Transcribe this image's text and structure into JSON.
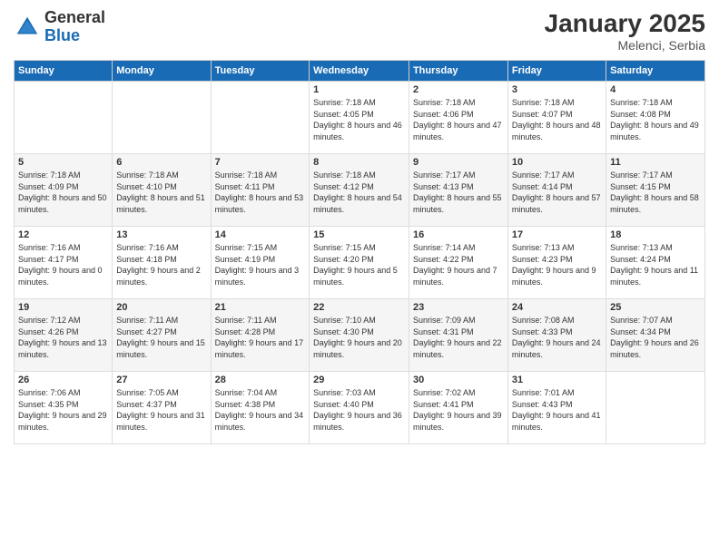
{
  "header": {
    "logo_general": "General",
    "logo_blue": "Blue",
    "month": "January 2025",
    "location": "Melenci, Serbia"
  },
  "days_of_week": [
    "Sunday",
    "Monday",
    "Tuesday",
    "Wednesday",
    "Thursday",
    "Friday",
    "Saturday"
  ],
  "weeks": [
    [
      null,
      null,
      null,
      {
        "day": "1",
        "sunrise": "7:18 AM",
        "sunset": "4:05 PM",
        "daylight": "8 hours and 46 minutes."
      },
      {
        "day": "2",
        "sunrise": "7:18 AM",
        "sunset": "4:06 PM",
        "daylight": "8 hours and 47 minutes."
      },
      {
        "day": "3",
        "sunrise": "7:18 AM",
        "sunset": "4:07 PM",
        "daylight": "8 hours and 48 minutes."
      },
      {
        "day": "4",
        "sunrise": "7:18 AM",
        "sunset": "4:08 PM",
        "daylight": "8 hours and 49 minutes."
      }
    ],
    [
      {
        "day": "5",
        "sunrise": "7:18 AM",
        "sunset": "4:09 PM",
        "daylight": "8 hours and 50 minutes."
      },
      {
        "day": "6",
        "sunrise": "7:18 AM",
        "sunset": "4:10 PM",
        "daylight": "8 hours and 51 minutes."
      },
      {
        "day": "7",
        "sunrise": "7:18 AM",
        "sunset": "4:11 PM",
        "daylight": "8 hours and 53 minutes."
      },
      {
        "day": "8",
        "sunrise": "7:18 AM",
        "sunset": "4:12 PM",
        "daylight": "8 hours and 54 minutes."
      },
      {
        "day": "9",
        "sunrise": "7:17 AM",
        "sunset": "4:13 PM",
        "daylight": "8 hours and 55 minutes."
      },
      {
        "day": "10",
        "sunrise": "7:17 AM",
        "sunset": "4:14 PM",
        "daylight": "8 hours and 57 minutes."
      },
      {
        "day": "11",
        "sunrise": "7:17 AM",
        "sunset": "4:15 PM",
        "daylight": "8 hours and 58 minutes."
      }
    ],
    [
      {
        "day": "12",
        "sunrise": "7:16 AM",
        "sunset": "4:17 PM",
        "daylight": "9 hours and 0 minutes."
      },
      {
        "day": "13",
        "sunrise": "7:16 AM",
        "sunset": "4:18 PM",
        "daylight": "9 hours and 2 minutes."
      },
      {
        "day": "14",
        "sunrise": "7:15 AM",
        "sunset": "4:19 PM",
        "daylight": "9 hours and 3 minutes."
      },
      {
        "day": "15",
        "sunrise": "7:15 AM",
        "sunset": "4:20 PM",
        "daylight": "9 hours and 5 minutes."
      },
      {
        "day": "16",
        "sunrise": "7:14 AM",
        "sunset": "4:22 PM",
        "daylight": "9 hours and 7 minutes."
      },
      {
        "day": "17",
        "sunrise": "7:13 AM",
        "sunset": "4:23 PM",
        "daylight": "9 hours and 9 minutes."
      },
      {
        "day": "18",
        "sunrise": "7:13 AM",
        "sunset": "4:24 PM",
        "daylight": "9 hours and 11 minutes."
      }
    ],
    [
      {
        "day": "19",
        "sunrise": "7:12 AM",
        "sunset": "4:26 PM",
        "daylight": "9 hours and 13 minutes."
      },
      {
        "day": "20",
        "sunrise": "7:11 AM",
        "sunset": "4:27 PM",
        "daylight": "9 hours and 15 minutes."
      },
      {
        "day": "21",
        "sunrise": "7:11 AM",
        "sunset": "4:28 PM",
        "daylight": "9 hours and 17 minutes."
      },
      {
        "day": "22",
        "sunrise": "7:10 AM",
        "sunset": "4:30 PM",
        "daylight": "9 hours and 20 minutes."
      },
      {
        "day": "23",
        "sunrise": "7:09 AM",
        "sunset": "4:31 PM",
        "daylight": "9 hours and 22 minutes."
      },
      {
        "day": "24",
        "sunrise": "7:08 AM",
        "sunset": "4:33 PM",
        "daylight": "9 hours and 24 minutes."
      },
      {
        "day": "25",
        "sunrise": "7:07 AM",
        "sunset": "4:34 PM",
        "daylight": "9 hours and 26 minutes."
      }
    ],
    [
      {
        "day": "26",
        "sunrise": "7:06 AM",
        "sunset": "4:35 PM",
        "daylight": "9 hours and 29 minutes."
      },
      {
        "day": "27",
        "sunrise": "7:05 AM",
        "sunset": "4:37 PM",
        "daylight": "9 hours and 31 minutes."
      },
      {
        "day": "28",
        "sunrise": "7:04 AM",
        "sunset": "4:38 PM",
        "daylight": "9 hours and 34 minutes."
      },
      {
        "day": "29",
        "sunrise": "7:03 AM",
        "sunset": "4:40 PM",
        "daylight": "9 hours and 36 minutes."
      },
      {
        "day": "30",
        "sunrise": "7:02 AM",
        "sunset": "4:41 PM",
        "daylight": "9 hours and 39 minutes."
      },
      {
        "day": "31",
        "sunrise": "7:01 AM",
        "sunset": "4:43 PM",
        "daylight": "9 hours and 41 minutes."
      },
      null
    ]
  ]
}
